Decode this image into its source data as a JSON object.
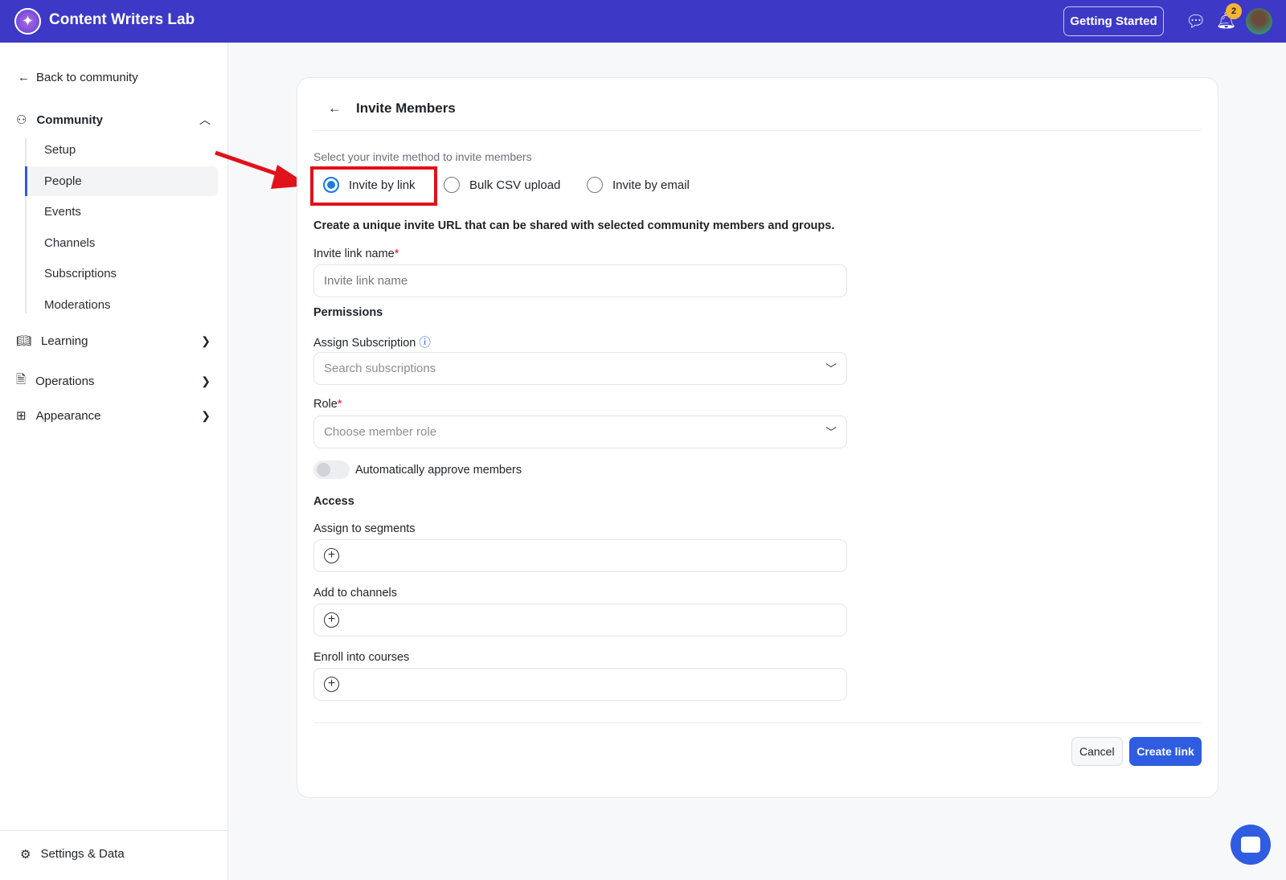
{
  "header": {
    "brand": "Content Writers Lab",
    "getting_started": "Getting Started",
    "notification_count": "2"
  },
  "sidebar": {
    "back": "Back to community",
    "community": "Community",
    "community_items": [
      "Setup",
      "People",
      "Events",
      "Channels",
      "Subscriptions",
      "Moderations"
    ],
    "learning": "Learning",
    "operations": "Operations",
    "appearance": "Appearance",
    "settings": "Settings & Data"
  },
  "card": {
    "title": "Invite Members",
    "method_prompt": "Select your invite method to invite members",
    "methods": [
      "Invite by link",
      "Bulk CSV upload",
      "Invite by email"
    ],
    "selected_method": "Invite by link",
    "description": "Create a unique invite URL that can be shared with selected community members and groups.",
    "link_name_label": "Invite link name",
    "link_name_placeholder": "Invite link name",
    "required": "*",
    "permissions": "Permissions",
    "subscription_label": "Assign Subscription",
    "subscription_placeholder": "Search subscriptions",
    "role_label": "Role",
    "role_placeholder": "Choose member role",
    "auto_approve": "Automatically approve members",
    "access": "Access",
    "segments_label": "Assign to segments",
    "channels_label": "Add to channels",
    "courses_label": "Enroll into courses",
    "cancel": "Cancel",
    "create": "Create link"
  },
  "colors": {
    "header": "#3d39c6",
    "primary": "#2f5ce0",
    "highlight": "#e0121b"
  }
}
